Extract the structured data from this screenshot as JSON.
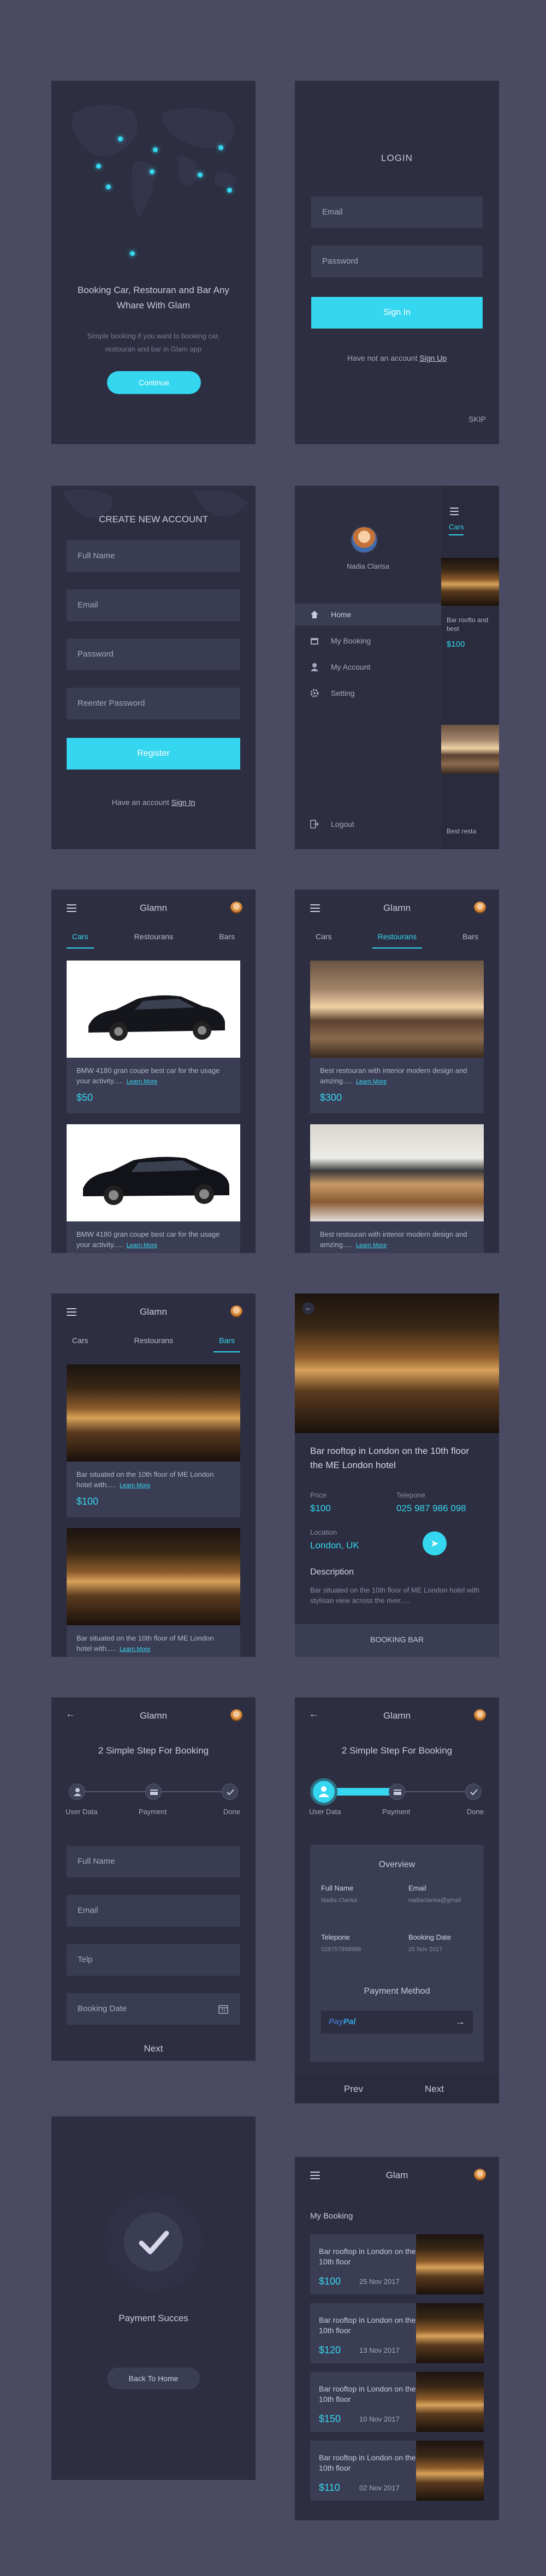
{
  "splash": {
    "title": "Booking Car, Restouran and Bar Any Whare With Glam",
    "desc": "Simple booking if you want to booking car, restouran and bar in Glam app",
    "cta": "Continue"
  },
  "login": {
    "title": "LOGIN",
    "email": "Email",
    "password": "Password",
    "signin": "Sign In",
    "no_account": "Have not an account",
    "signup": "Sign Up",
    "skip": "SKIP"
  },
  "register": {
    "title": "CREATE NEW ACCOUNT",
    "full_name": "Full Name",
    "email": "Email",
    "password": "Password",
    "reenter": "Reenter Password",
    "register": "Register",
    "have_account": "Have an account",
    "signin": "Sign In"
  },
  "menu": {
    "user": "Nadia Clarisa",
    "items": [
      "Home",
      "My Booking",
      "My Account",
      "Setting"
    ],
    "logout": "Logout",
    "peek_tab": "Cars",
    "peek_text": "Bar roofto and best",
    "peek_price": "$100",
    "peek_text2": "Best resta"
  },
  "app": {
    "name": "Glamn",
    "tabs": [
      "Cars",
      "Restourans",
      "Bars"
    ],
    "learn_more": "Learn More"
  },
  "cars": [
    {
      "text": "BMW 4180 gran coupe best car for the usage your activity.....",
      "price": "$50"
    },
    {
      "text": "BMW 4180 gran coupe best car for the usage your activity.....",
      "price": ""
    }
  ],
  "restaurants": [
    {
      "text": "Best restouran with interior modern design and amzing.....",
      "price": "$300"
    },
    {
      "text": "Best restouran with interior modern design and amzing.....",
      "price": ""
    }
  ],
  "bars": [
    {
      "text": "Bar situated on the 10th floor of ME London hotel with.....",
      "price": "$100"
    },
    {
      "text": "Bar situated on the 10th floor of ME London hotel with.....",
      "price": ""
    }
  ],
  "detail": {
    "title": "Bar rooftop in London on the 10th floor the ME London hotel",
    "price_label": "Price",
    "price": "$100",
    "tel_label": "Telepone",
    "tel": "025 987 986 098",
    "loc_label": "Location",
    "loc": "London, UK",
    "desc_label": "Description",
    "desc": "Bar situated on the 10th floor of ME London hotel with stylisan view across the river.....",
    "cta": "BOOKING BAR"
  },
  "booking1": {
    "title": "Glamn",
    "subtitle": "2 Simple Step For Booking",
    "steps": [
      "User Data",
      "Payment",
      "Done"
    ],
    "full_name": "Full Name",
    "email": "Email",
    "telp": "Telp",
    "date": "Booking Date",
    "next": "Next"
  },
  "booking2": {
    "title": "Glamn",
    "subtitle": "2 Simple Step For Booking",
    "steps": [
      "User Data",
      "Payment",
      "Done"
    ],
    "overview": "Overview",
    "fn_label": "Full Name",
    "fn": "Nadia Clarisa",
    "em_label": "Email",
    "em": "nadiaclarisa@gmail",
    "tel_label": "Telepone",
    "tel": "028757898986",
    "bd_label": "Booking Date",
    "bd": "25 Nov 2017",
    "pm": "Payment Method",
    "paypal1": "Pay",
    "paypal2": "Pal",
    "prev": "Prev",
    "next": "Next"
  },
  "success": {
    "text": "Payment Succes",
    "back": "Back To Home"
  },
  "mybooking": {
    "title": "Glam",
    "heading": "My Booking",
    "rows": [
      {
        "text": "Bar rooftop in London on the 10th floor",
        "price": "$100",
        "date": "25 Nov 2017"
      },
      {
        "text": "Bar rooftop in London on the 10th floor",
        "price": "$120",
        "date": "13 Nov 2017"
      },
      {
        "text": "Bar rooftop in London on the 10th floor",
        "price": "$150",
        "date": "10 Nov 2017"
      },
      {
        "text": "Bar rooftop in London on the 10th floor",
        "price": "$110",
        "date": "02 Nov 2017"
      }
    ]
  },
  "colors": {
    "bg": "#4a4a62",
    "screen": "#2d2e41",
    "accent": "#35d6ef"
  }
}
